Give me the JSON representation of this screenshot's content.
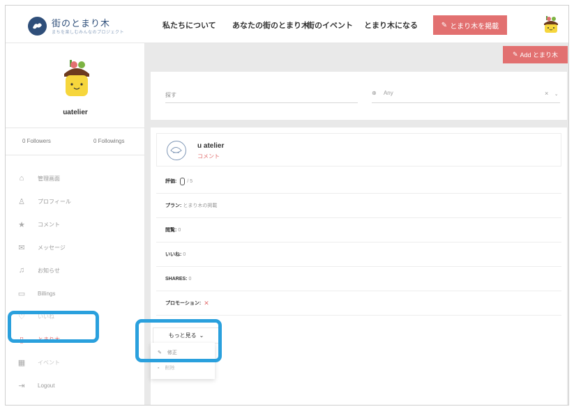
{
  "header": {
    "logo_title": "街のとまり木",
    "logo_subtitle": "まちを楽しむみんなのプロジェクト",
    "nav": [
      "私たちについて",
      "あなたの街のとまり木",
      "街のイベント",
      "とまり木になる"
    ],
    "cta_label": "とまり木を掲載"
  },
  "profile": {
    "username": "uatelier",
    "followers": "0 Followers",
    "followings": "0 Followings"
  },
  "sidebar": {
    "items": [
      {
        "label": "管理画面",
        "icon": "home-icon"
      },
      {
        "label": "プロフィール",
        "icon": "user-icon"
      },
      {
        "label": "コメント",
        "icon": "star-icon"
      },
      {
        "label": "メッセージ",
        "icon": "envelope-icon"
      },
      {
        "label": "お知らせ",
        "icon": "bell-icon"
      },
      {
        "label": "Billings",
        "icon": "card-icon"
      },
      {
        "label": "いいね",
        "icon": "heart-icon"
      },
      {
        "label": "とまり木",
        "icon": "book-icon"
      },
      {
        "label": "イベント",
        "icon": "calendar-icon"
      },
      {
        "label": "Logout",
        "icon": "logout-icon"
      }
    ]
  },
  "main": {
    "add_button": "Add とまり木",
    "search_placeholder": "探す",
    "any_select": "Any",
    "item": {
      "name": "u atelier",
      "comment": "コメント",
      "rating_label": "評価:",
      "rating_value": "/ 5",
      "plan_label": "プラン:",
      "plan_value": "とまり木の掲載",
      "views_label": "閲覧:",
      "views_value": "0",
      "likes_label": "いいね:",
      "likes_value": "0",
      "shares_label": "SHARES:",
      "shares_value": "0",
      "promotion_label": "プロモーション:",
      "promotion_value": "✕"
    },
    "more_button": "もっと見る",
    "dropdown": [
      "修正",
      "削除"
    ]
  },
  "colors": {
    "accent": "#e27070",
    "highlight": "#2aa0dd",
    "brand": "#2f4f7a"
  }
}
